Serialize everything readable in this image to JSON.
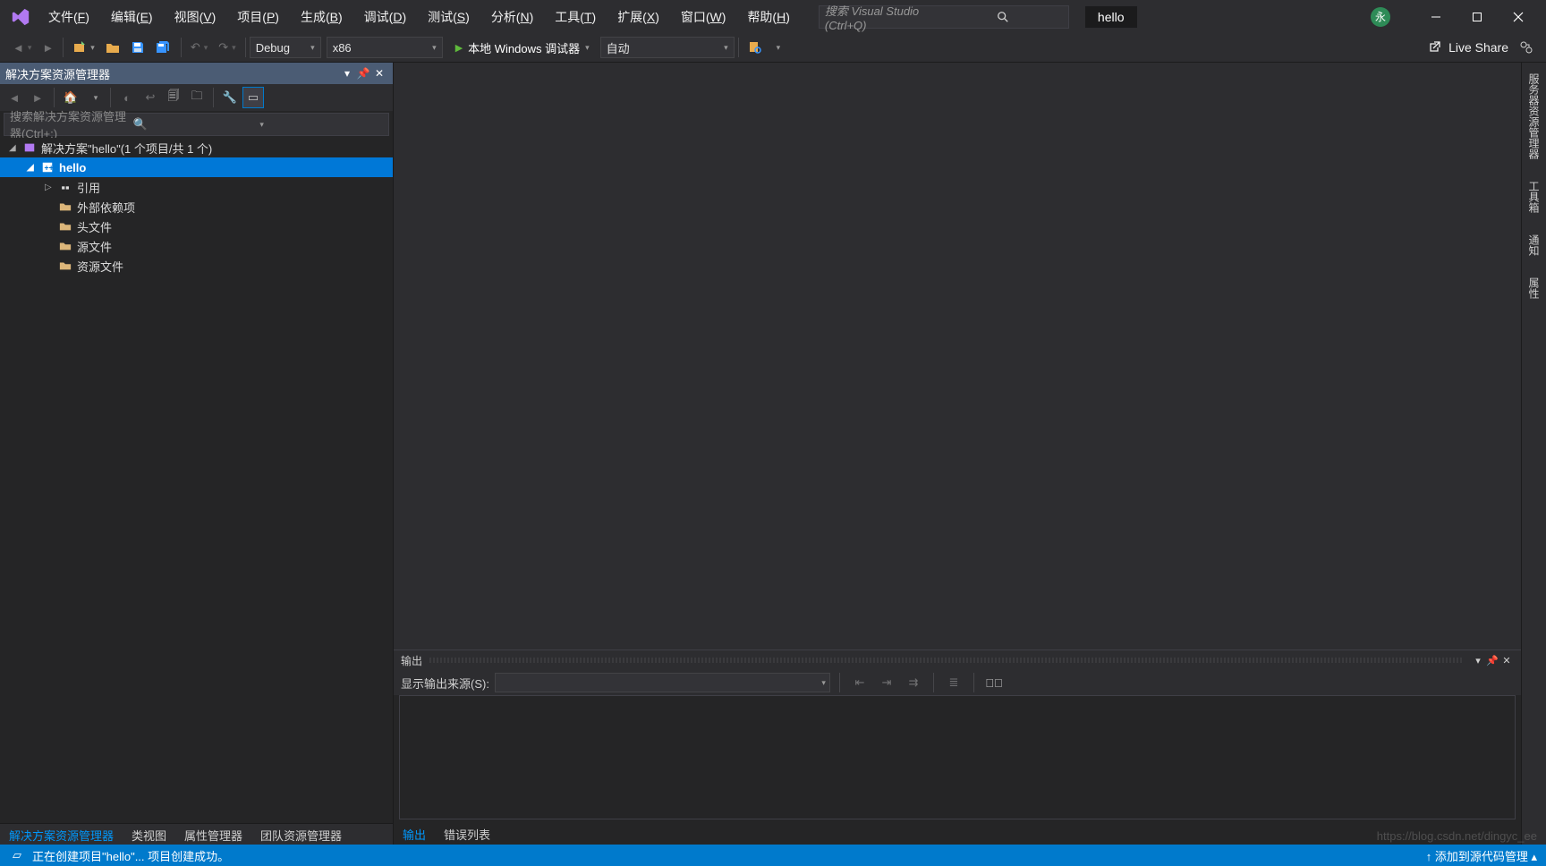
{
  "menu": {
    "items": [
      {
        "pre": "文件(",
        "u": "F",
        "post": ")"
      },
      {
        "pre": "编辑(",
        "u": "E",
        "post": ")"
      },
      {
        "pre": "视图(",
        "u": "V",
        "post": ")"
      },
      {
        "pre": "项目(",
        "u": "P",
        "post": ")"
      },
      {
        "pre": "生成(",
        "u": "B",
        "post": ")"
      },
      {
        "pre": "调试(",
        "u": "D",
        "post": ")"
      },
      {
        "pre": "测试(",
        "u": "S",
        "post": ")"
      },
      {
        "pre": "分析(",
        "u": "N",
        "post": ")"
      },
      {
        "pre": "工具(",
        "u": "T",
        "post": ")"
      },
      {
        "pre": "扩展(",
        "u": "X",
        "post": ")"
      },
      {
        "pre": "窗口(",
        "u": "W",
        "post": ")"
      },
      {
        "pre": "帮助(",
        "u": "H",
        "post": ")"
      }
    ],
    "search_placeholder": "搜索 Visual Studio (Ctrl+Q)",
    "project_name": "hello",
    "avatar_text": "永"
  },
  "toolbar": {
    "config": "Debug",
    "platform": "x86",
    "debug_target": "本地 Windows 调试器",
    "auto": "自动",
    "live_share": "Live Share"
  },
  "solution_panel": {
    "title": "解决方案资源管理器",
    "search_placeholder": "搜索解决方案资源管理器(Ctrl+;)",
    "root": "解决方案\"hello\"(1 个项目/共 1 个)",
    "project": "hello",
    "nodes": [
      "引用",
      "外部依赖项",
      "头文件",
      "源文件",
      "资源文件"
    ],
    "tabs": [
      "解决方案资源管理器",
      "类视图",
      "属性管理器",
      "团队资源管理器"
    ]
  },
  "output_panel": {
    "title": "输出",
    "source_label": "显示输出来源(S):",
    "tabs": [
      "输出",
      "错误列表"
    ]
  },
  "right_rail": {
    "tabs": [
      "服务器资源管理器",
      "工具箱",
      "通知",
      "属性"
    ]
  },
  "statusbar": {
    "text": "正在创建项目\"hello\"... 项目创建成功。",
    "right": "↑  添加到源代码管理 ▴"
  },
  "watermark": "https://blog.csdn.net/dingyc_ee",
  "colors": {
    "accent": "#007acc",
    "selection": "#0078d7"
  }
}
